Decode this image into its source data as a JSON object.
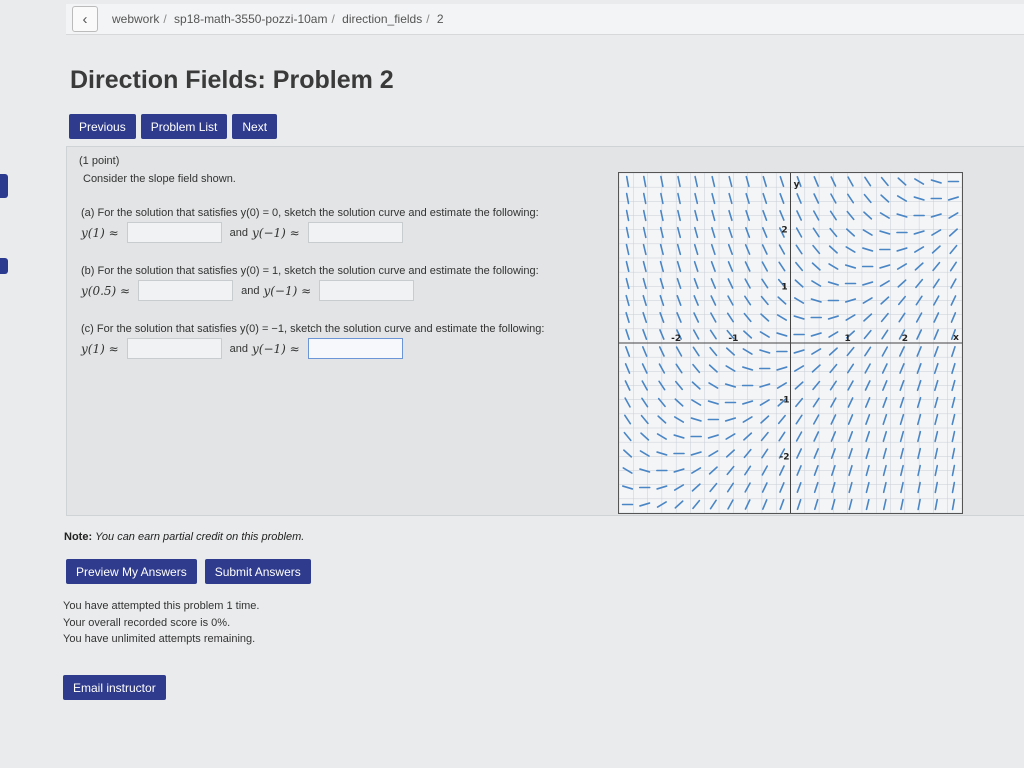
{
  "breadcrumb": [
    "webwork",
    "sp18-math-3550-pozzi-10am",
    "direction_fields",
    "2"
  ],
  "page_title": "Direction Fields: Problem 2",
  "nav": {
    "previous": "Previous",
    "problem_list": "Problem List",
    "next": "Next"
  },
  "problem": {
    "points": "(1 point)",
    "intro": "Consider the slope field shown.",
    "parts": [
      {
        "question": "(a) For the solution that satisfies y(0) = 0, sketch the solution curve and estimate the following:",
        "label1": "y(1) ≈",
        "and": "and",
        "label2": "y(−1) ≈",
        "value1": "",
        "value2": ""
      },
      {
        "question": "(b) For the solution that satisfies y(0) = 1, sketch the solution curve and estimate the following:",
        "label1": "y(0.5) ≈",
        "and": "and",
        "label2": "y(−1) ≈",
        "value1": "",
        "value2": ""
      },
      {
        "question": "(c) For the solution that satisfies y(0) = −1, sketch the solution curve and estimate the following:",
        "label1": "y(1) ≈",
        "and": "and",
        "label2": "y(−1) ≈",
        "value1": "",
        "value2": ""
      }
    ]
  },
  "slope_field": {
    "x_label": "x",
    "y_label": "y",
    "x_ticks": [
      "-2",
      "-1",
      "1",
      "2"
    ],
    "y_ticks": [
      "2",
      "1",
      "-1",
      "-2"
    ],
    "x_range": [
      -3,
      3
    ],
    "y_range": [
      -3,
      3
    ],
    "segment_color": "#4a86c5",
    "grid_color": "#c9ced6"
  },
  "note": {
    "label": "Note:",
    "text": "You can earn partial credit on this problem."
  },
  "answers": {
    "preview": "Preview My Answers",
    "submit": "Submit Answers"
  },
  "status": [
    "You have attempted this problem 1 time.",
    "Your overall recorded score is 0%.",
    "You have unlimited attempts remaining."
  ],
  "email": "Email instructor"
}
